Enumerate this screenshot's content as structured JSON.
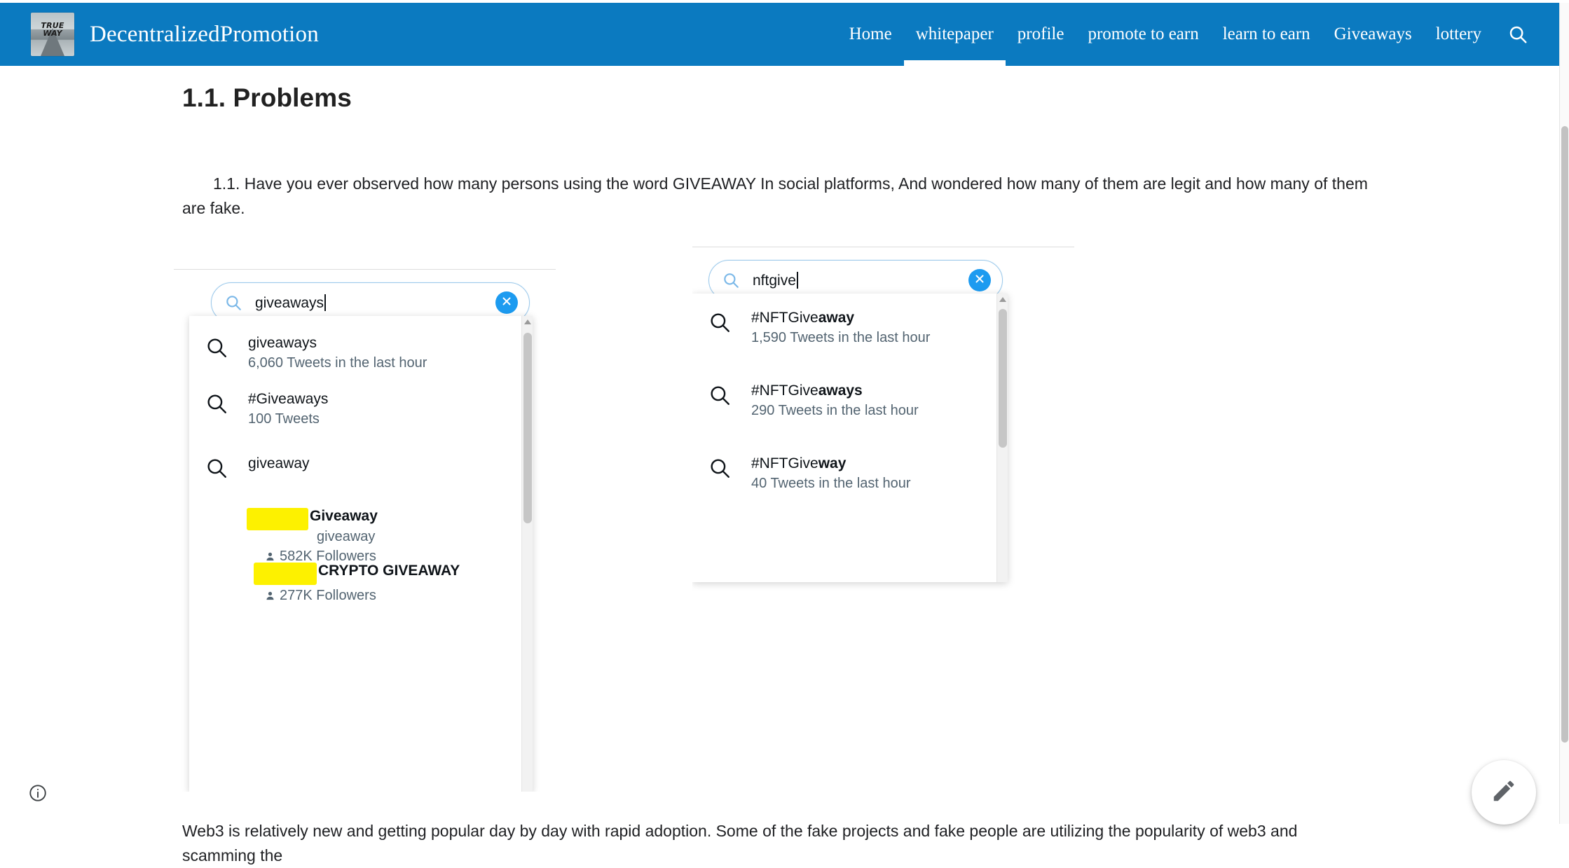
{
  "header": {
    "brand_logo_text": "TRUE\nWAY",
    "brand_logo_line1": "TRUE",
    "brand_logo_line2": "WAY",
    "brand_title": "DecentralizedPromotion",
    "accent_color": "#0b7ac0",
    "nav": [
      {
        "label": "Home",
        "active": false
      },
      {
        "label": "whitepaper",
        "active": true
      },
      {
        "label": "profile",
        "active": false
      },
      {
        "label": "promote to earn",
        "active": false
      },
      {
        "label": "learn to earn",
        "active": false
      },
      {
        "label": "Giveaways",
        "active": false
      },
      {
        "label": "lottery",
        "active": false
      }
    ],
    "search_icon": "search-icon"
  },
  "document": {
    "heading": "1.1. Problems",
    "paragraph_1": "1.1. Have you ever observed how many persons using the word GIVEAWAY In social platforms, And wondered how many of them are legit and how many of them are fake.",
    "paragraph_2": "Web3 is relatively new and getting popular day by day with rapid adoption. Some of the fake projects and fake people are utilizing the popularity of web3 and scamming the"
  },
  "screenshot_left": {
    "search": {
      "value": "giveaways",
      "icon": "search-icon",
      "clear_icon": "close-circle-icon"
    },
    "suggestions": [
      {
        "title_plain": "giveaways",
        "title_bold": "",
        "sub": "6,060 Tweets in the last hour"
      },
      {
        "title_plain": "#Giveaways",
        "title_bold": "",
        "sub": "100 Tweets"
      },
      {
        "title_plain": "giveaway",
        "title_bold": "",
        "sub": ""
      }
    ],
    "accounts": [
      {
        "name": "Giveaway",
        "handle": "giveaway",
        "followers": "582K Followers",
        "redacted": true
      },
      {
        "name": "CRYPTO GIVEAWAY",
        "handle": "",
        "followers": "277K Followers",
        "redacted": true
      }
    ],
    "highlight_color": "#fdf100"
  },
  "screenshot_right": {
    "search": {
      "value": "nftgive",
      "icon": "search-icon",
      "clear_icon": "close-circle-icon"
    },
    "suggestions": [
      {
        "title_plain": "#NFTGive",
        "title_bold": "away",
        "sub": "1,590 Tweets in the last hour"
      },
      {
        "title_plain": "#NFTGive",
        "title_bold": "aways",
        "sub": "290 Tweets in the last hour"
      },
      {
        "title_plain": "#NFTGive",
        "title_bold": "way",
        "sub": "40 Tweets in the last hour"
      }
    ]
  },
  "footer": {
    "info_icon": "info-circle-icon",
    "edit_fab_icon": "pencil-edit-icon"
  }
}
